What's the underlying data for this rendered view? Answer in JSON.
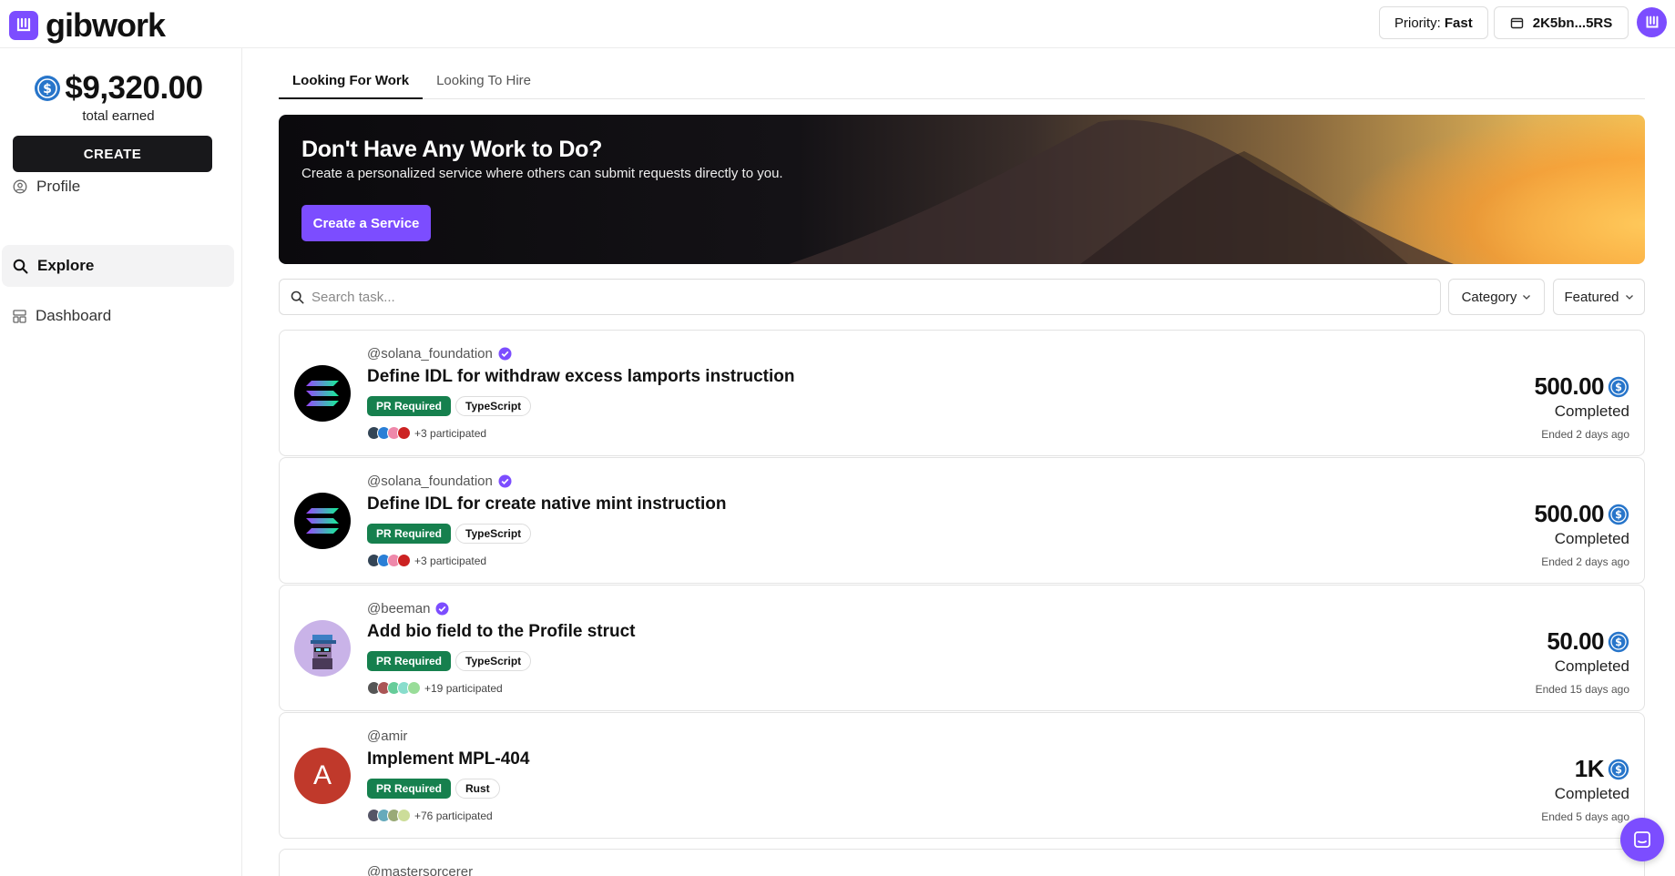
{
  "header": {
    "logo_text": "gibwork",
    "priority_label": "Priority:",
    "priority_value": "Fast",
    "wallet": "2K5bn...5RS",
    "brand_color": "#7c4dff"
  },
  "sidebar": {
    "earned_amount": "$9,320.00",
    "earned_label": "total earned",
    "create_label": "CREATE",
    "items": [
      {
        "label": "Profile",
        "icon": "user-circle-icon"
      },
      {
        "label": "Explore",
        "icon": "search-icon",
        "active": true
      },
      {
        "label": "Dashboard",
        "icon": "dashboard-icon"
      }
    ]
  },
  "tabs": [
    {
      "label": "Looking For Work",
      "active": true
    },
    {
      "label": "Looking To Hire"
    }
  ],
  "banner": {
    "title": "Don't Have Any Work to Do?",
    "subtitle": "Create a personalized service where others can submit requests directly to you.",
    "button": "Create a Service"
  },
  "search": {
    "placeholder": "Search task...",
    "category_label": "Category",
    "sort_label": "Featured"
  },
  "tasks": [
    {
      "user": "@solana_foundation",
      "verified": true,
      "title": "Define IDL for withdraw excess lamports instruction",
      "pr_tag": "PR Required",
      "lang": "TypeScript",
      "participants": "+3 participated",
      "amount": "500.00",
      "status": "Completed",
      "ended": "Ended 2 days ago"
    },
    {
      "user": "@solana_foundation",
      "verified": true,
      "title": "Define IDL for create native mint instruction",
      "pr_tag": "PR Required",
      "lang": "TypeScript",
      "participants": "+3 participated",
      "amount": "500.00",
      "status": "Completed",
      "ended": "Ended 2 days ago"
    },
    {
      "user": "@beeman",
      "verified": true,
      "title": "Add bio field to the Profile struct",
      "pr_tag": "PR Required",
      "lang": "TypeScript",
      "participants": "+19 participated",
      "amount": "50.00",
      "status": "Completed",
      "ended": "Ended 15 days ago"
    },
    {
      "user": "@amir",
      "verified": false,
      "avatar_letter": "A",
      "title": "Implement MPL-404",
      "pr_tag": "PR Required",
      "lang": "Rust",
      "participants": "+76 participated",
      "amount": "1K",
      "status": "Completed",
      "ended": "Ended 5 days ago"
    },
    {
      "user": "@mastersorcerer"
    }
  ]
}
